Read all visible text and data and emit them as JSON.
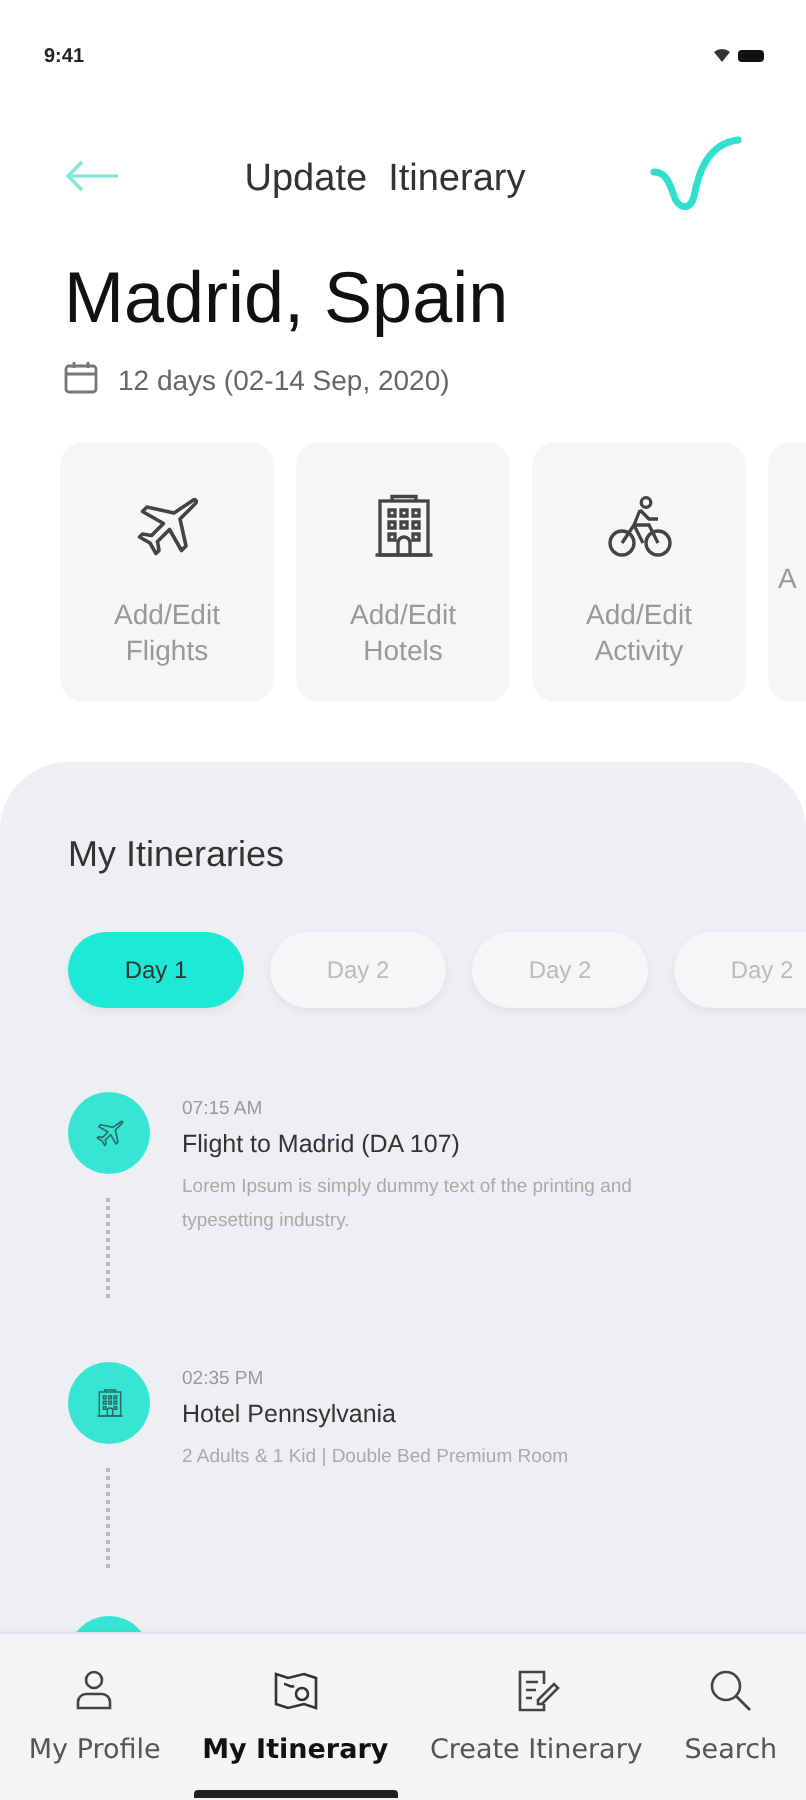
{
  "status_bar": {
    "time": "9:41"
  },
  "header": {
    "title": "Update  Itinerary"
  },
  "trip": {
    "city": "Madrid, Spain",
    "dates": "12 days (02-14 Sep, 2020)"
  },
  "actions": [
    {
      "kind": "plane",
      "label": "Add/Edit Flights"
    },
    {
      "kind": "hotel",
      "label": "Add/Edit Hotels"
    },
    {
      "kind": "bike",
      "label": "Add/Edit Activity"
    },
    {
      "kind": "none",
      "label": "A"
    }
  ],
  "itineraries": {
    "title": "My Itineraries",
    "days": [
      {
        "label": "Day 1",
        "selected": true
      },
      {
        "label": "Day 2",
        "selected": false
      },
      {
        "label": "Day 2",
        "selected": false
      },
      {
        "label": "Day 2",
        "selected": false
      }
    ],
    "events": [
      {
        "kind": "plane",
        "time": "07:15 AM",
        "title": "Flight to Madrid (DA 107)",
        "detail": "Lorem Ipsum is simply dummy text of the printing and typesetting industry."
      },
      {
        "kind": "hotel",
        "time": "02:35 PM",
        "title": "Hotel Pennsylvania",
        "detail": "2 Adults & 1 Kid  |  Double Bed Premium Room"
      }
    ]
  },
  "tab_bar": [
    {
      "kind": "profile",
      "label": "My Profile",
      "selected": false
    },
    {
      "kind": "map",
      "label": "My Itinerary",
      "selected": true
    },
    {
      "kind": "edit",
      "label": "Create Itinerary",
      "selected": false
    },
    {
      "kind": "search",
      "label": "Search",
      "selected": false
    }
  ]
}
